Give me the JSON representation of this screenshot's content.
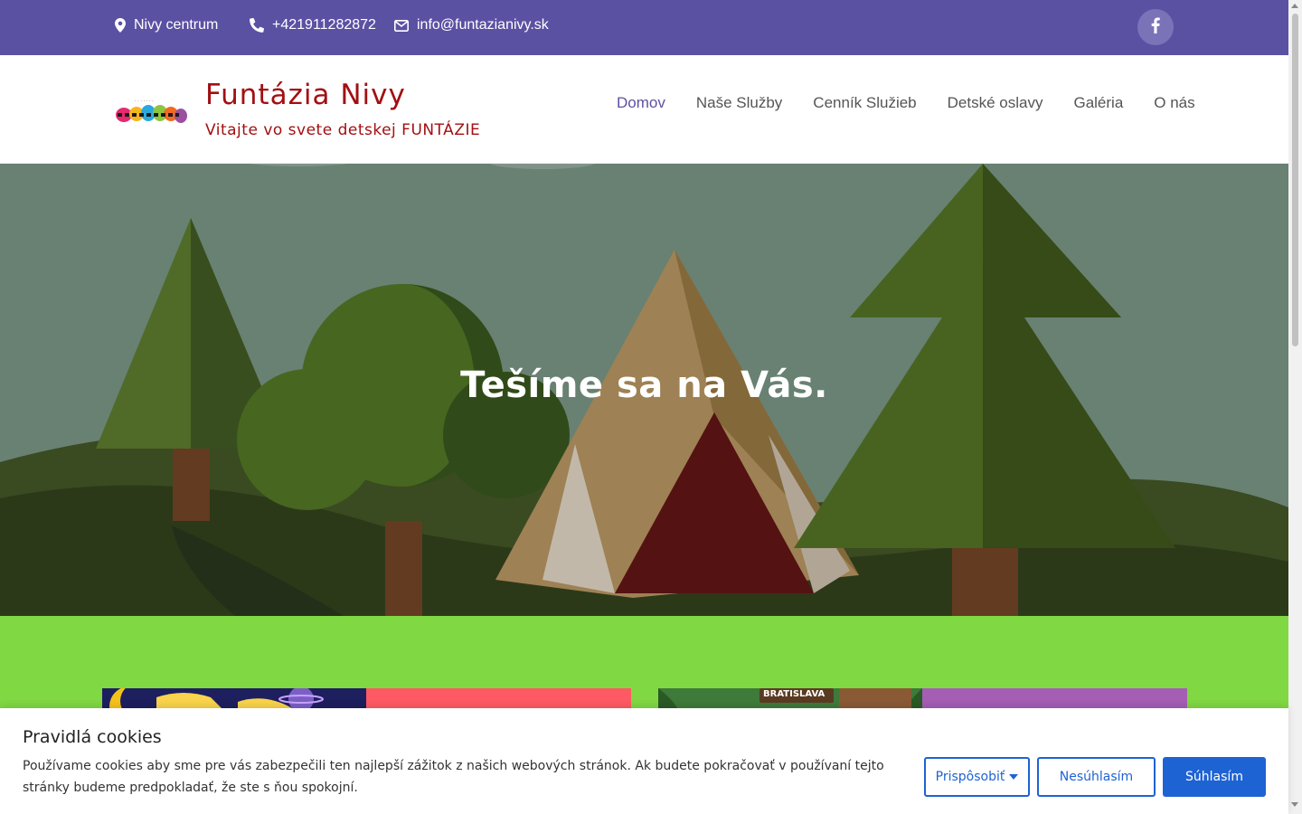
{
  "topbar": {
    "location": "Nivy centrum",
    "phone": "+421911282872",
    "email": "info@funtazianivy.sk",
    "bg_color": "#5b51a3"
  },
  "header": {
    "site_title": "Funtázia Nivy",
    "tagline": "Vitajte vo svete detskej FUNTÁZIE",
    "nav": [
      {
        "label": "Domov",
        "active": true
      },
      {
        "label": "Naše Služby",
        "active": false
      },
      {
        "label": "Cenník Služieb",
        "active": false
      },
      {
        "label": "Detské oslavy",
        "active": false
      },
      {
        "label": "Galéria",
        "active": false
      },
      {
        "label": "O nás",
        "active": false
      }
    ]
  },
  "hero": {
    "title": "Tešíme sa na Vás."
  },
  "cards": [
    {
      "image_text": "",
      "accent_color": "#fe5a64"
    },
    {
      "image_badge": "BRATISLAVA",
      "accent_color": "#a45eb3"
    }
  ],
  "cookie_banner": {
    "title": "Pravidlá cookies",
    "text": "Používame cookies aby sme pre vás zabezpečili ten najlepší zážitok z našich webových stránok. Ak budete pokračovať v používaní tejto stránky budeme predpokladať, že ste s ňou spokojní.",
    "customize_label": "Prispôsobiť",
    "decline_label": "Nesúhlasím",
    "accept_label": "Súhlasím",
    "accent_color": "#1e63d3"
  },
  "icons": {
    "location": "map-marker-icon",
    "phone": "phone-icon",
    "email": "envelope-icon",
    "facebook": "facebook-icon"
  }
}
